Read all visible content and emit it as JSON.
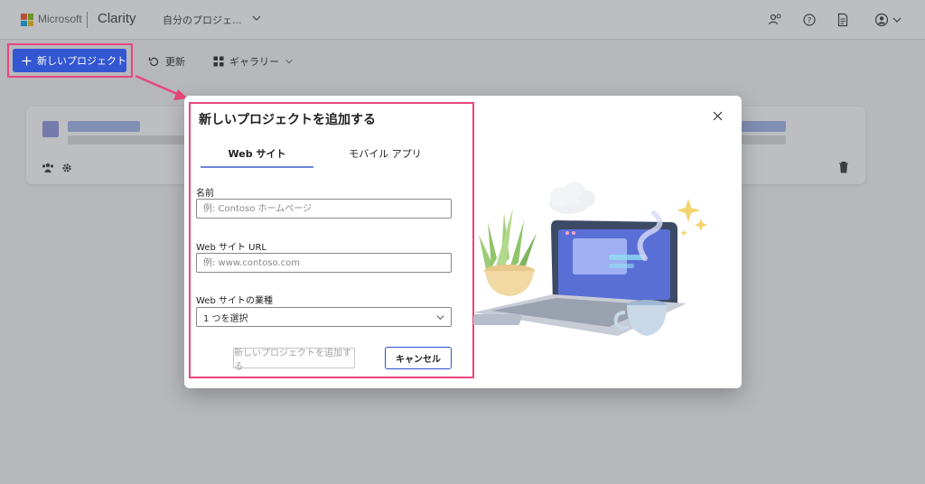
{
  "header": {
    "brand": "Microsoft",
    "app_name": "Clarity",
    "project_selector": "自分のプロジェ...",
    "icons": [
      "people-settings-icon",
      "help-icon",
      "document-icon",
      "account-icon"
    ]
  },
  "toolbar": {
    "new_project_label": "新しいプロジェクト",
    "refresh_label": "更新",
    "gallery_label": "ギャラリー"
  },
  "dialog": {
    "title": "新しいプロジェクトを追加する",
    "tabs": [
      {
        "label": "Web サイト",
        "active": true
      },
      {
        "label": "モバイル アプリ",
        "active": false
      }
    ],
    "fields": {
      "name_label": "名前",
      "name_placeholder": "例: Contoso ホームページ",
      "url_label": "Web サイト URL",
      "url_placeholder": "例: www.contoso.com",
      "industry_label": "Web サイトの業種",
      "industry_value": "1 つを選択"
    },
    "add_button": "新しいプロジェクトを追加する",
    "cancel_button": "キャンセル"
  },
  "colors": {
    "accent": "#2b4fcf",
    "highlight": "#e8457a",
    "tab_underline": "#6e82d6"
  }
}
